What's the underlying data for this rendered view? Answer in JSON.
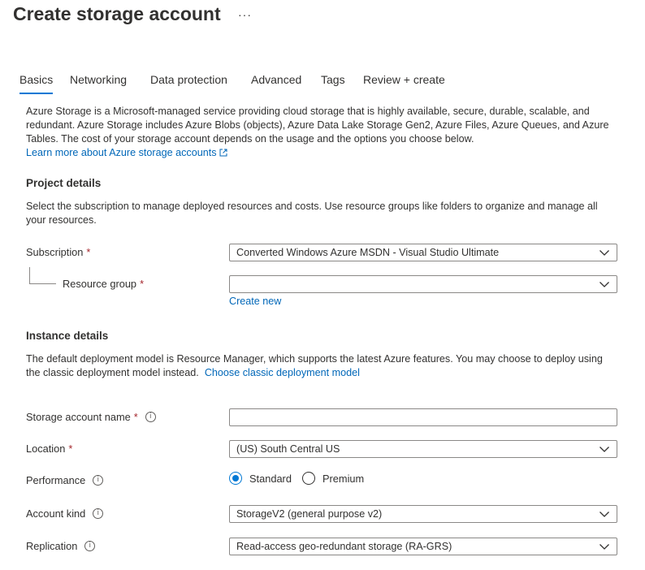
{
  "header": {
    "title": "Create storage account",
    "more": "···"
  },
  "tabs": [
    {
      "label": "Basics"
    },
    {
      "label": "Networking"
    },
    {
      "label": "Data protection"
    },
    {
      "label": "Advanced"
    },
    {
      "label": "Tags"
    },
    {
      "label": "Review + create"
    }
  ],
  "intro": {
    "text": "Azure Storage is a Microsoft-managed service providing cloud storage that is highly available, secure, durable, scalable, and redundant. Azure Storage includes Azure Blobs (objects), Azure Data Lake Storage Gen2, Azure Files, Azure Queues, and Azure Tables. The cost of your storage account depends on the usage and the options you choose below.",
    "link": "Learn more about Azure storage accounts"
  },
  "project": {
    "heading": "Project details",
    "desc": "Select the subscription to manage deployed resources and costs. Use resource groups like folders to organize and manage all your resources.",
    "subscription_label": "Subscription",
    "subscription_value": "Converted Windows Azure MSDN - Visual Studio Ultimate",
    "resource_group_label": "Resource group",
    "resource_group_value": "",
    "create_new": "Create new"
  },
  "instance": {
    "heading": "Instance details",
    "desc": "The default deployment model is Resource Manager, which supports the latest Azure features. You may choose to deploy using the classic deployment model instead.",
    "classic_link": "Choose classic deployment model",
    "name_label": "Storage account name",
    "name_value": "",
    "location_label": "Location",
    "location_value": "(US) South Central US",
    "performance_label": "Performance",
    "performance_options": [
      "Standard",
      "Premium"
    ],
    "performance_selected": "Standard",
    "kind_label": "Account kind",
    "kind_value": "StorageV2 (general purpose v2)",
    "replication_label": "Replication",
    "replication_value": "Read-access geo-redundant storage (RA-GRS)"
  },
  "required_mark": "*",
  "colors": {
    "accent": "#0078d4",
    "link": "#0067b8",
    "required": "#a4262c"
  }
}
